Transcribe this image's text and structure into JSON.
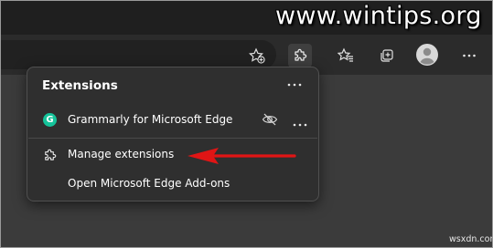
{
  "watermark": "www.wintips.org",
  "watermark2": "wsxdn.com",
  "toolbar": {
    "icons": [
      "add-favorite-icon",
      "extensions-icon",
      "favorites-icon",
      "collections-icon",
      "profile-icon",
      "more-icon"
    ]
  },
  "extensions_menu": {
    "title": "Extensions",
    "more_label": "•••",
    "items": [
      {
        "label": "Grammarly for Microsoft Edge",
        "icon": "grammarly-icon",
        "icon_letter": "G"
      },
      {
        "label": "Manage extensions",
        "icon": "puzzle-icon"
      },
      {
        "label": "Open Microsoft Edge Add-ons"
      }
    ]
  },
  "colors": {
    "arrow": "#e01515",
    "grammarly": "#15c39a",
    "panel": "#2f2f2f"
  }
}
